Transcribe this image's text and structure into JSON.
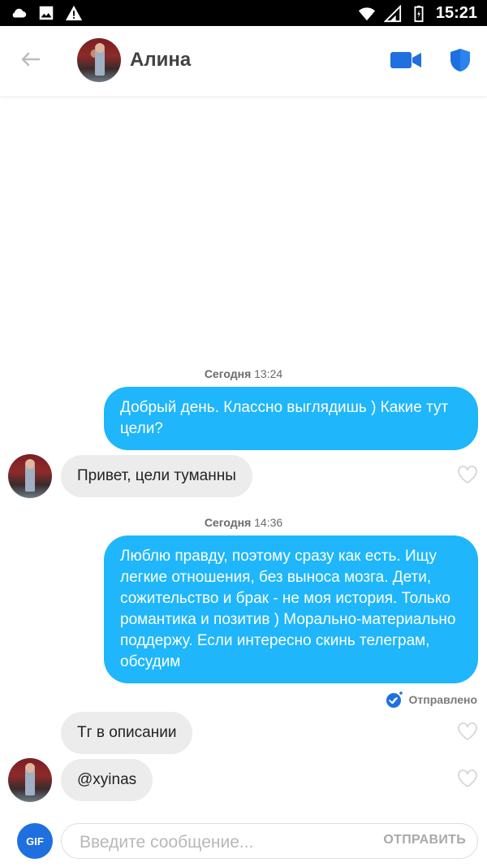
{
  "status_bar": {
    "time": "15:21",
    "icons_left": [
      "cloud-icon",
      "image-icon",
      "warning-icon"
    ],
    "icons_right": [
      "wifi-icon",
      "signal-icon",
      "battery-icon"
    ]
  },
  "header": {
    "back_icon": "arrow-left-icon",
    "contact_name": "Алина",
    "actions": [
      "video-camera-icon",
      "shield-icon"
    ],
    "accent_color": "#1f6fe0"
  },
  "messages": [
    {
      "type": "date",
      "day": "Сегодня",
      "time": "13:24"
    },
    {
      "type": "outgoing",
      "text": "Добрый день. Классно выглядишь ) Какие тут цели?"
    },
    {
      "type": "incoming",
      "text": "Привет, цели туманны"
    },
    {
      "type": "date",
      "day": "Сегодня",
      "time": "14:36"
    },
    {
      "type": "outgoing",
      "text": "Люблю правду, поэтому сразу как есть. Ищу легкие отношения, без выноса мозга. Дети, сожительство и брак - не моя история. Только романтика и позитив ) Морально-материально поддержу. Если интересно скинь телеграм, обсудим"
    },
    {
      "type": "status",
      "text": "Отправлено"
    },
    {
      "type": "incoming",
      "text": "Тг в описании"
    },
    {
      "type": "incoming",
      "text": "@xyinas"
    }
  ],
  "composer": {
    "gif_label": "GIF",
    "placeholder": "Введите сообщение...",
    "send_label": "ОТПРАВИТЬ"
  },
  "colors": {
    "outgoing_bubble": "#1fb6fb",
    "incoming_bubble": "#ececec"
  }
}
